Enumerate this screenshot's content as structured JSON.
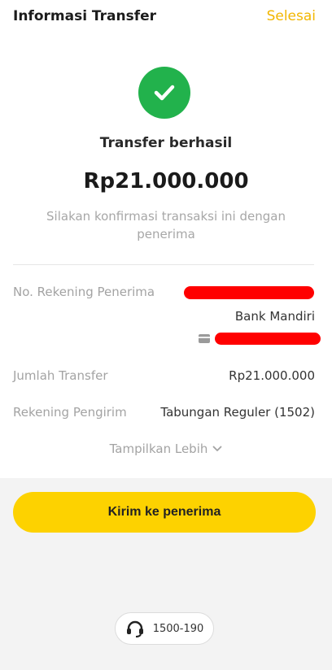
{
  "header": {
    "title": "Informasi Transfer",
    "done_label": "Selesai"
  },
  "status": {
    "icon": "check-icon",
    "color": "#22b24c",
    "text": "Transfer berhasil"
  },
  "amount": "Rp21.000.000",
  "note": "Silakan konfirmasi transaksi ini dengan penerima",
  "details": {
    "recipient_account_label": "No. Rekening Penerima",
    "recipient_bank": "Bank Mandiri",
    "transfer_amount_label": "Jumlah Transfer",
    "transfer_amount_value": "Rp21.000.000",
    "sender_account_label": "Rekening Pengirim",
    "sender_account_value": "Tabungan Reguler (1502)"
  },
  "show_more_label": "Tampilkan Lebih",
  "send_button_label": "Kirim ke penerima",
  "support": {
    "icon": "headset-icon",
    "phone": "1500-190"
  },
  "colors": {
    "accent": "#fdd200",
    "done_link": "#f2b600",
    "redaction": "#ff0000"
  }
}
